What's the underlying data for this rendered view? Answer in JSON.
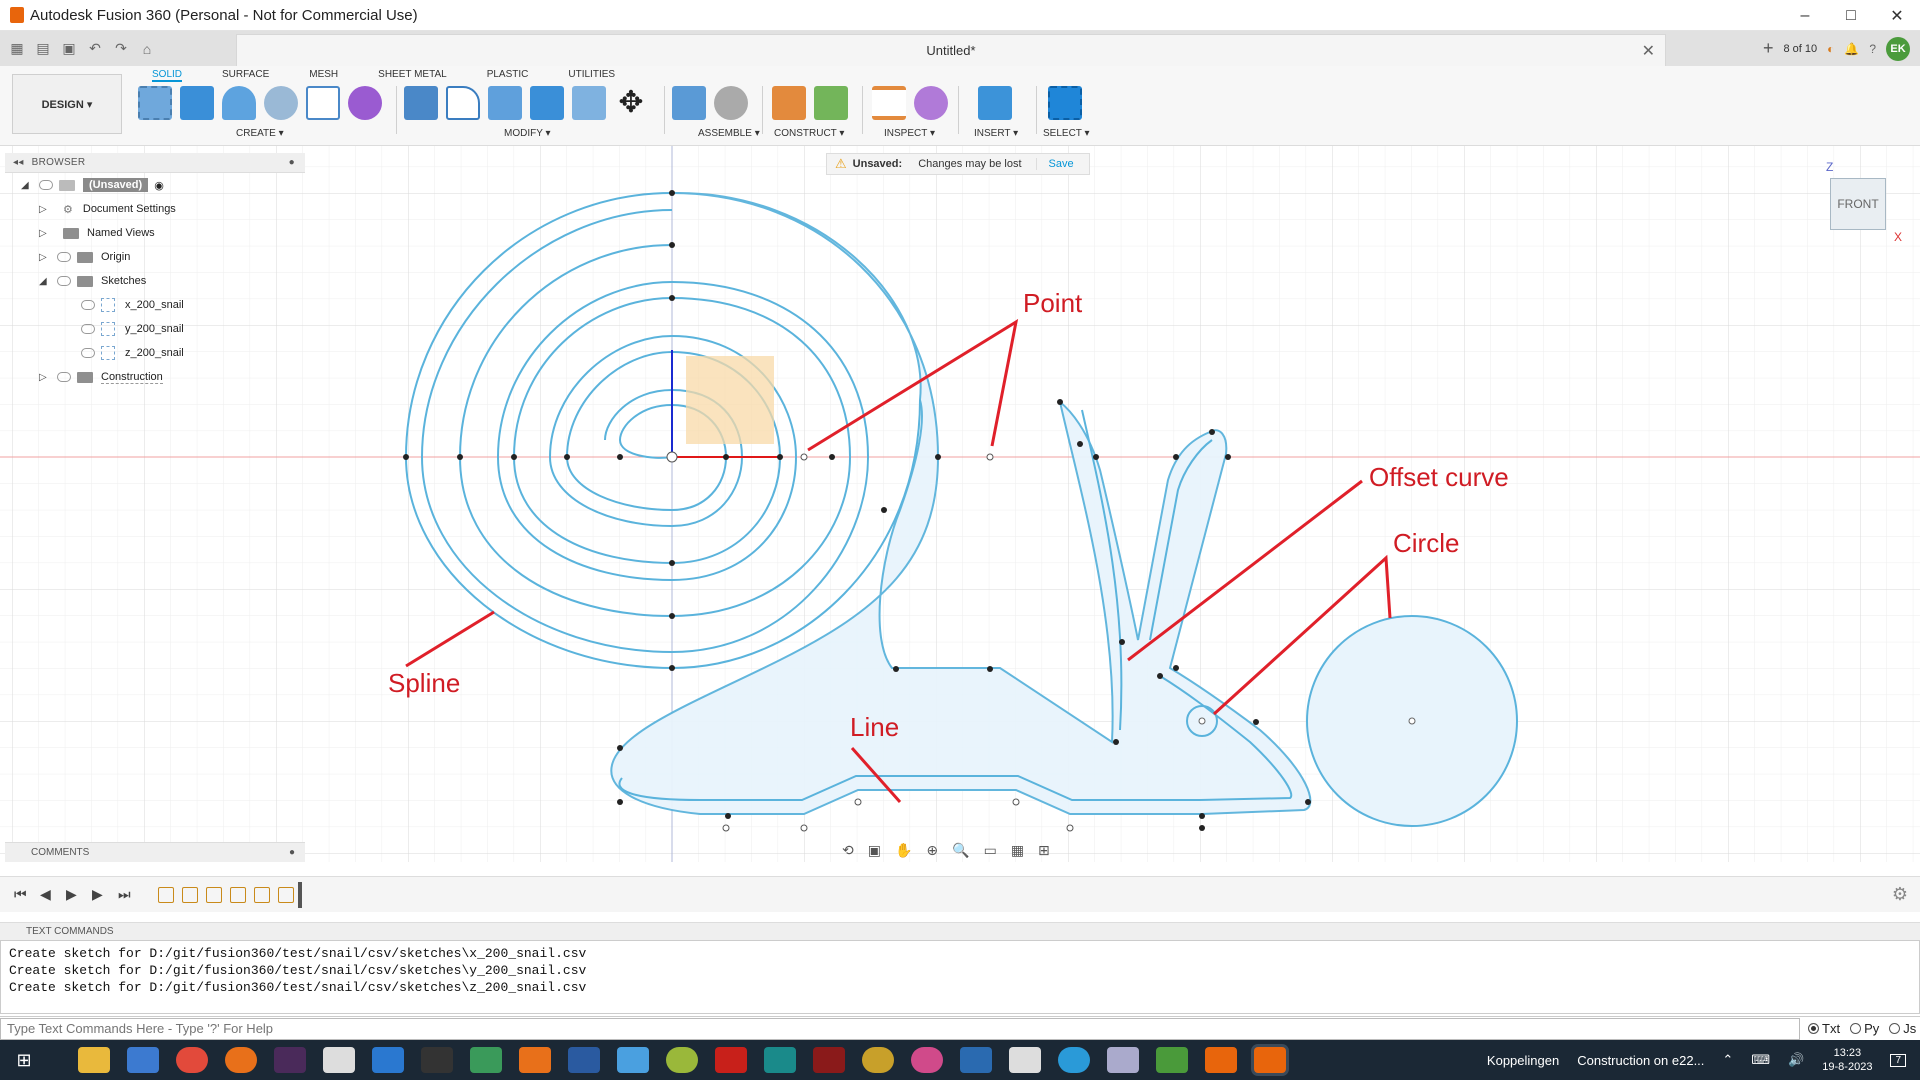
{
  "window": {
    "title": "Autodesk Fusion 360 (Personal - Not for Commercial Use)",
    "minimize": "–",
    "maximize": "□",
    "close": "✕"
  },
  "doc_tab": {
    "title": "Untitled*",
    "close": "✕"
  },
  "tabbar_right": {
    "jobs": "8 of 10",
    "user_initials": "EK"
  },
  "workspace": {
    "label": "DESIGN ▾"
  },
  "ribbon_tabs": [
    "SOLID",
    "SURFACE",
    "MESH",
    "SHEET METAL",
    "PLASTIC",
    "UTILITIES"
  ],
  "groups": {
    "create": "CREATE ▾",
    "modify": "MODIFY ▾",
    "assemble": "ASSEMBLE ▾",
    "construct": "CONSTRUCT ▾",
    "inspect": "INSPECT ▾",
    "insert": "INSERT ▾",
    "select": "SELECT ▾"
  },
  "browser": {
    "title": "BROWSER",
    "root": "(Unsaved)",
    "items": [
      "Document Settings",
      "Named Views",
      "Origin",
      "Sketches"
    ],
    "sketches": [
      "x_200_snail",
      "y_200_snail",
      "z_200_snail"
    ],
    "construction": "Construction"
  },
  "unsaved_banner": {
    "label": "Unsaved:",
    "message": "Changes may be lost",
    "save": "Save"
  },
  "viewcube": {
    "face": "FRONT",
    "axis_z": "Z",
    "axis_x": "X"
  },
  "annotations": {
    "point": "Point",
    "offset_curve": "Offset curve",
    "circle": "Circle",
    "spline": "Spline",
    "line": "Line"
  },
  "comments": {
    "title": "COMMENTS"
  },
  "text_commands": {
    "title": "TEXT COMMANDS",
    "lines": [
      "Create sketch for D:/git/fusion360/test/snail/csv/sketches\\x_200_snail.csv",
      "Create sketch for D:/git/fusion360/test/snail/csv/sketches\\y_200_snail.csv",
      "Create sketch for D:/git/fusion360/test/snail/csv/sketches\\z_200_snail.csv"
    ],
    "placeholder": "Type Text Commands Here - Type '?' For Help",
    "radios": [
      "Txt",
      "Py",
      "Js"
    ],
    "selected": "Txt"
  },
  "taskbar": {
    "tray_label": "Koppelingen",
    "active_window": "Construction on e22...",
    "time": "13:23",
    "date": "19-8-2023",
    "notif": "7"
  },
  "colors": {
    "accent": "#0696d7",
    "sketch_fill": "#e8f4fc",
    "sketch_line": "#5ab3dc",
    "annotation": "#e0202a",
    "taskbar": "#1b2835"
  }
}
